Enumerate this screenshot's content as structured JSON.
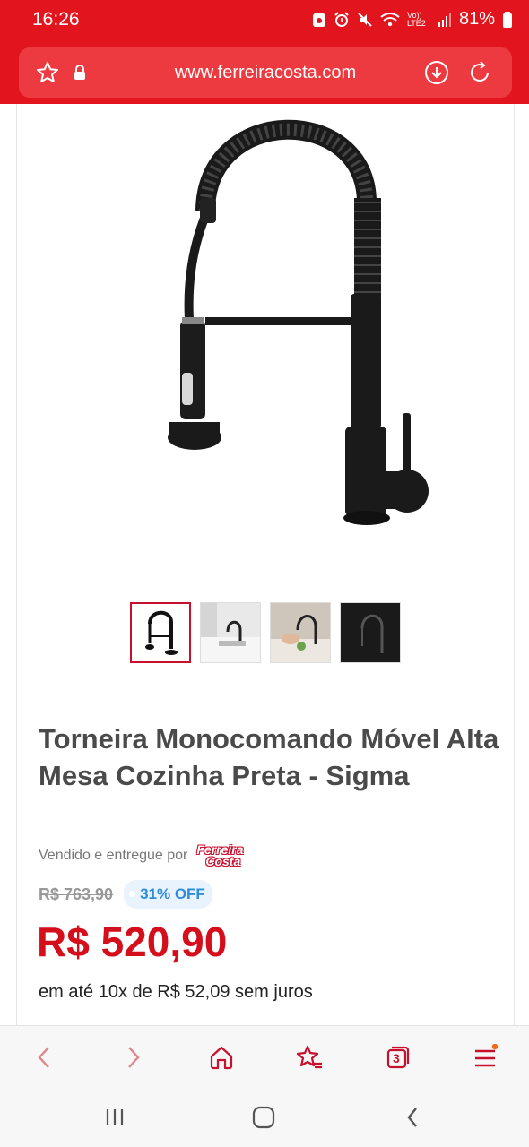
{
  "status_bar": {
    "time": "16:26",
    "network": "Vo)) LTE2",
    "battery": "81%"
  },
  "address_bar": {
    "url": "www.ferreiracosta.com"
  },
  "product": {
    "image_icon": "faucet-image",
    "thumbnails": [
      {
        "name": "thumb-faucet-white-bg",
        "active": true
      },
      {
        "name": "thumb-faucet-kitchen",
        "active": false
      },
      {
        "name": "thumb-faucet-washing",
        "active": false
      },
      {
        "name": "thumb-faucet-dark-bg",
        "active": false
      }
    ],
    "title": "Torneira Monocomando Móvel Alta Mesa Cozinha Preta - Sigma",
    "seller_label": "Vendido e entregue por",
    "seller_logo_line1": "Ferreira",
    "seller_logo_line2": "Costa",
    "old_price": "R$ 763,90",
    "discount": "31% OFF",
    "price": "R$ 520,90",
    "installments": "em até 10x de R$ 52,09 sem juros"
  },
  "toolbar": {
    "tabs_count": "3"
  },
  "colors": {
    "brand_red": "#e2141d",
    "price_red": "#d40f1b",
    "discount_blue": "#2c8ce0"
  }
}
